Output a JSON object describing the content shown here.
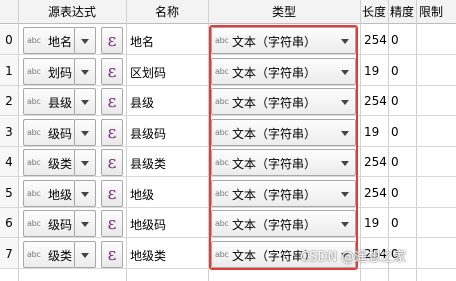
{
  "columns": {
    "source_expr": "源表达式",
    "name": "名称",
    "type": "类型",
    "length": "长度",
    "precision": "精度",
    "limit": "限制"
  },
  "abc_label": "abc",
  "eps_symbol": "ε",
  "rows": [
    {
      "num": "0",
      "source": "地名",
      "name": "地名",
      "type": "文本（字符串）",
      "length": "254",
      "precision": "0"
    },
    {
      "num": "1",
      "source": "划码",
      "name": "区划码",
      "type": "文本（字符串）",
      "length": "19",
      "precision": "0"
    },
    {
      "num": "2",
      "source": "县级",
      "name": "县级",
      "type": "文本（字符串）",
      "length": "254",
      "precision": "0"
    },
    {
      "num": "3",
      "source": "级码",
      "name": "县级码",
      "type": "文本（字符串）",
      "length": "19",
      "precision": "0"
    },
    {
      "num": "4",
      "source": "级类",
      "name": "县级类",
      "type": "文本（字符串）",
      "length": "254",
      "precision": "0"
    },
    {
      "num": "5",
      "source": "地级",
      "name": "地级",
      "type": "文本（字符串）",
      "length": "254",
      "precision": "0"
    },
    {
      "num": "6",
      "source": "级码",
      "name": "地级码",
      "type": "文本（字符串）",
      "length": "19",
      "precision": "0"
    },
    {
      "num": "7",
      "source": "级类",
      "name": "地级类",
      "type": "文本（字符串）",
      "length": "254",
      "precision": "0"
    }
  ],
  "watermark": "CSDN @遥想之家",
  "highlight_color": "#e53a3a"
}
